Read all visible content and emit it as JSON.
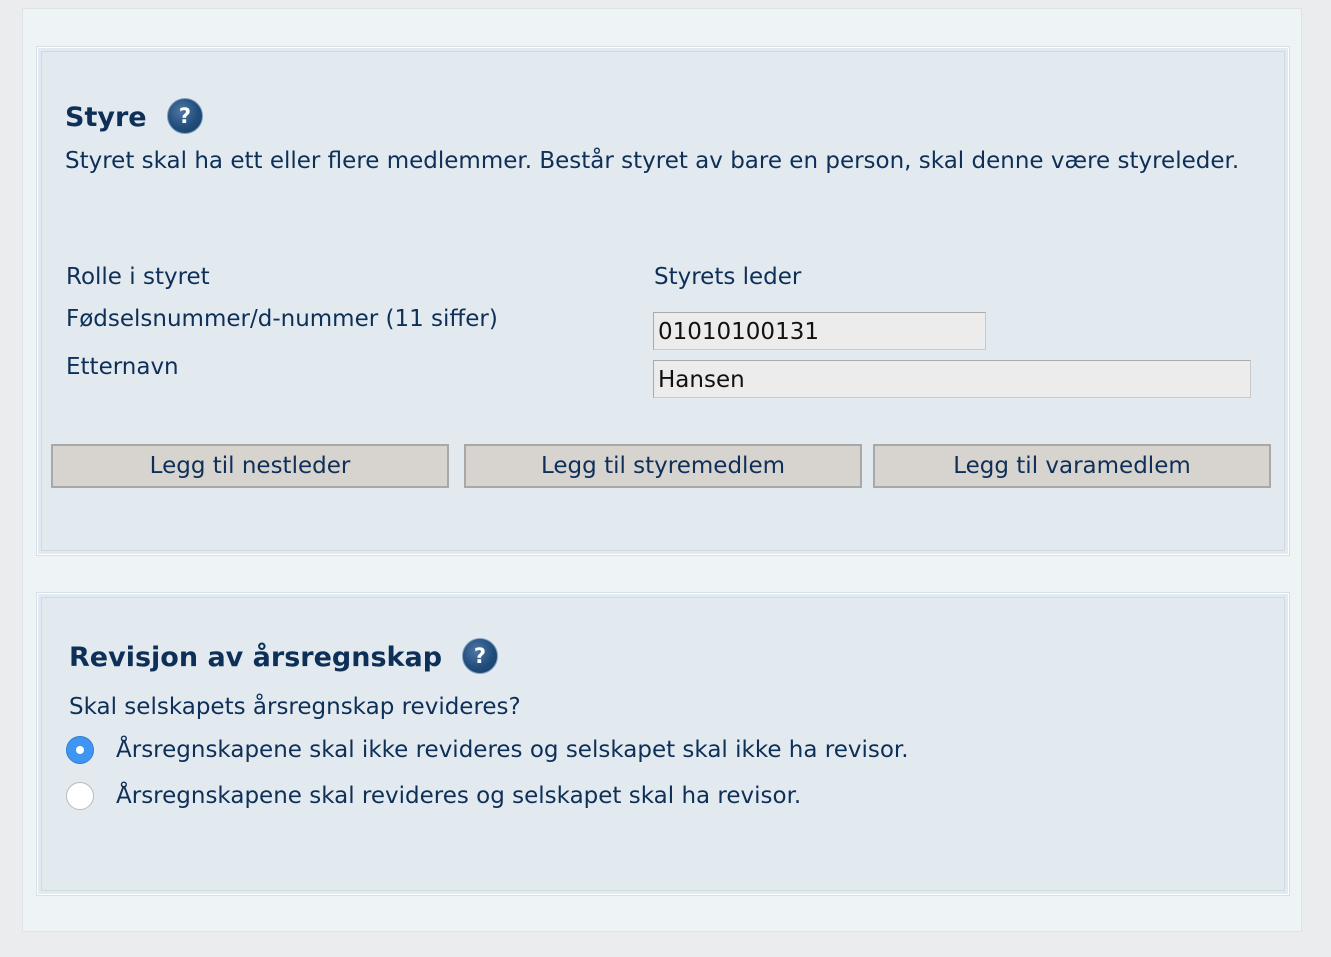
{
  "board": {
    "title": "Styre",
    "help_icon": "question-mark-icon",
    "description": "Styret skal ha ett eller flere medlemmer. Består styret av bare en person, skal denne være styreleder.",
    "role_label": "Rolle i styret",
    "role_value": "Styrets leder",
    "ssn_label": "Fødselsnummer/d-nummer (11 siffer)",
    "ssn_value": "01010100131",
    "lastname_label": "Etternavn",
    "lastname_value": "Hansen",
    "buttons": {
      "add_deputy": "Legg til nestleder",
      "add_member": "Legg til styremedlem",
      "add_alternate": "Legg til varamedlem"
    }
  },
  "audit": {
    "title": "Revisjon av årsregnskap",
    "help_icon": "question-mark-icon",
    "question": "Skal selskapets årsregnskap revideres?",
    "options": [
      {
        "label": "Årsregnskapene skal ikke revideres og selskapet skal ikke ha revisor.",
        "selected": true
      },
      {
        "label": "Årsregnskapene skal revideres og selskapet skal ha revisor.",
        "selected": false
      }
    ]
  },
  "colors": {
    "heading": "#0e2f57",
    "panel_bg": "#e2eaf0",
    "radio_selected": "#3e95f2"
  }
}
